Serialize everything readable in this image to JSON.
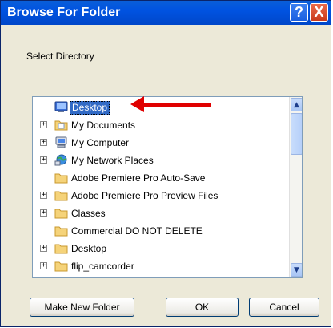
{
  "window": {
    "title": "Browse For Folder",
    "help_glyph": "?",
    "close_glyph": "X",
    "help_icon": "help-icon",
    "close_icon": "close-icon"
  },
  "prompt_label": "Select Directory",
  "tree": {
    "items": [
      {
        "label": "Desktop",
        "icon": "desktop-icon",
        "expander": "",
        "selected": true
      },
      {
        "label": "My Documents",
        "icon": "documents-folder-icon",
        "expander": "+"
      },
      {
        "label": "My Computer",
        "icon": "computer-icon",
        "expander": "+"
      },
      {
        "label": "My Network Places",
        "icon": "network-places-icon",
        "expander": "+"
      },
      {
        "label": "Adobe Premiere Pro Auto-Save",
        "icon": "folder-icon",
        "expander": ""
      },
      {
        "label": "Adobe Premiere Pro Preview Files",
        "icon": "folder-icon",
        "expander": "+"
      },
      {
        "label": "Classes",
        "icon": "folder-icon",
        "expander": "+"
      },
      {
        "label": "Commercial DO NOT DELETE",
        "icon": "folder-icon",
        "expander": ""
      },
      {
        "label": "Desktop",
        "icon": "folder-icon",
        "expander": "+"
      },
      {
        "label": "flip_camcorder",
        "icon": "folder-icon",
        "expander": "+"
      }
    ],
    "scroll_up_glyph": "▲",
    "scroll_down_glyph": "▼"
  },
  "buttons": {
    "make_new_folder": "Make New Folder",
    "ok": "OK",
    "cancel": "Cancel"
  },
  "annotation": {
    "arrow_color": "#e00000"
  },
  "colors": {
    "title_bar": "#0053e1",
    "selection": "#316ac5",
    "dialog_bg": "#ece9d8"
  }
}
